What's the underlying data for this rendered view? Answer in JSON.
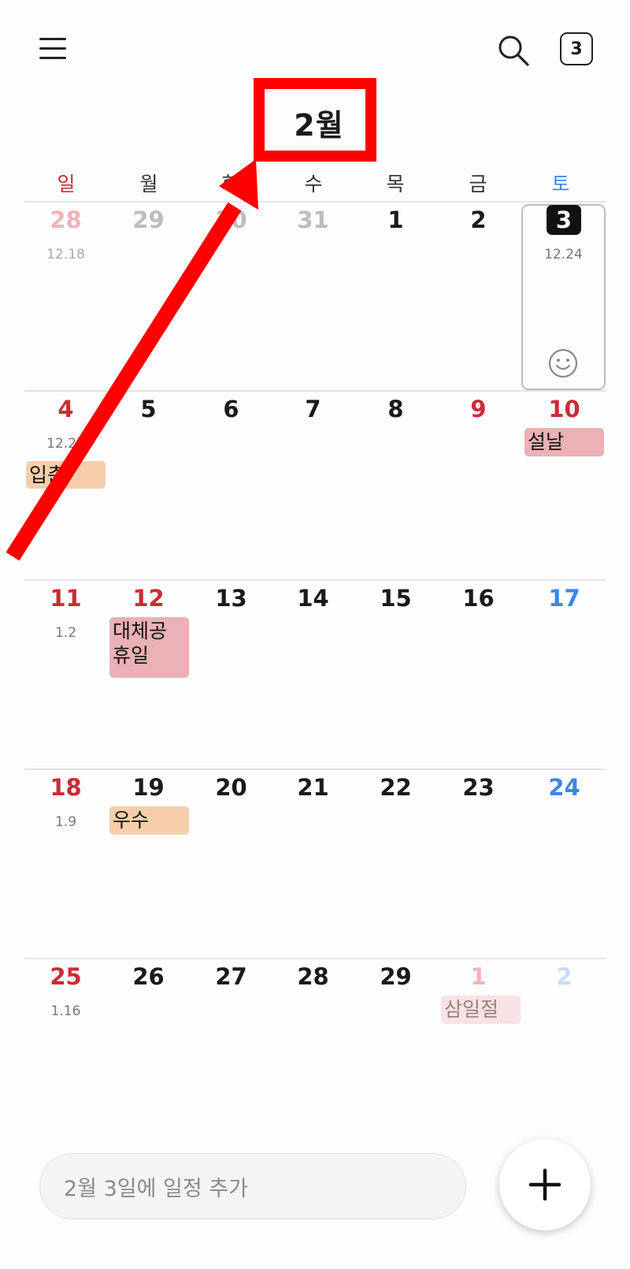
{
  "header": {
    "month_title": "2월",
    "today_button_label": "3"
  },
  "weekdays": [
    "일",
    "월",
    "화",
    "수",
    "목",
    "금",
    "토"
  ],
  "weeks": [
    {
      "days": [
        {
          "num": "28",
          "lunar": "12.18"
        },
        {
          "num": "29",
          "lunar": ""
        },
        {
          "num": "30",
          "lunar": ""
        },
        {
          "num": "31",
          "lunar": ""
        },
        {
          "num": "1",
          "lunar": ""
        },
        {
          "num": "2",
          "lunar": ""
        },
        {
          "num": "3",
          "lunar": "12.24"
        }
      ]
    },
    {
      "days": [
        {
          "num": "4",
          "lunar": "12.25"
        },
        {
          "num": "5",
          "lunar": ""
        },
        {
          "num": "6",
          "lunar": ""
        },
        {
          "num": "7",
          "lunar": ""
        },
        {
          "num": "8",
          "lunar": ""
        },
        {
          "num": "9",
          "lunar": ""
        },
        {
          "num": "10",
          "lunar": ""
        }
      ]
    },
    {
      "days": [
        {
          "num": "11",
          "lunar": "1.2"
        },
        {
          "num": "12",
          "lunar": ""
        },
        {
          "num": "13",
          "lunar": ""
        },
        {
          "num": "14",
          "lunar": ""
        },
        {
          "num": "15",
          "lunar": ""
        },
        {
          "num": "16",
          "lunar": ""
        },
        {
          "num": "17",
          "lunar": ""
        }
      ]
    },
    {
      "days": [
        {
          "num": "18",
          "lunar": "1.9"
        },
        {
          "num": "19",
          "lunar": ""
        },
        {
          "num": "20",
          "lunar": ""
        },
        {
          "num": "21",
          "lunar": ""
        },
        {
          "num": "22",
          "lunar": ""
        },
        {
          "num": "23",
          "lunar": ""
        },
        {
          "num": "24",
          "lunar": ""
        }
      ]
    },
    {
      "days": [
        {
          "num": "25",
          "lunar": "1.16"
        },
        {
          "num": "26",
          "lunar": ""
        },
        {
          "num": "27",
          "lunar": ""
        },
        {
          "num": "28",
          "lunar": ""
        },
        {
          "num": "29",
          "lunar": ""
        },
        {
          "num": "1",
          "lunar": ""
        },
        {
          "num": "2",
          "lunar": ""
        }
      ]
    }
  ],
  "events": {
    "ipchun": "입춘",
    "seollal": "설날",
    "substitute_holiday": "대체공\n휴일",
    "usu": "우수",
    "samiljeol": "삼일절"
  },
  "add_event": {
    "placeholder": "2월 3일에 일정 추가"
  },
  "colors": {
    "sunday_red": "#cc2b36",
    "saturday_blue": "#3d86e6",
    "event_orange": "#f5cfab",
    "event_pink": "#ebb1b5",
    "annotation_red": "#ff0000"
  },
  "icons": {
    "menu": "hamburger-menu-icon",
    "search": "search-icon",
    "add": "plus-icon",
    "mood": "smiley-icon"
  }
}
